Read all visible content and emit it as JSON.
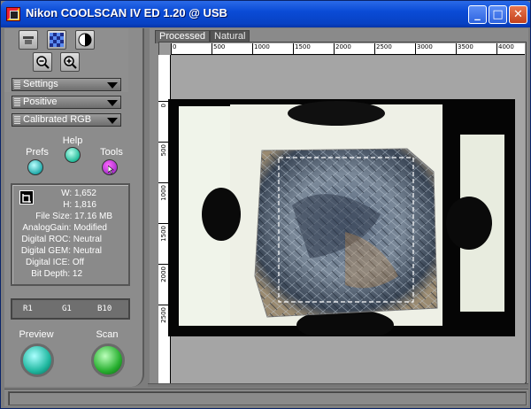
{
  "window": {
    "title": "Nikon COOLSCAN IV ED 1.20 @ USB",
    "minimize_label": "_",
    "maximize_label": "□",
    "close_label": "✕"
  },
  "toolbar": {
    "icons": [
      "scanner-icon",
      "checkerboard-icon",
      "contrast-icon",
      "zoom-out-icon",
      "zoom-in-icon"
    ]
  },
  "dropdowns": {
    "settings": "Settings",
    "film_type": "Positive",
    "color_space": "Calibrated RGB"
  },
  "tools": {
    "prefs": "Prefs",
    "help": "Help",
    "tools": "Tools"
  },
  "info": {
    "width": "W: 1,652",
    "height": "H: 1,816",
    "file_size": "File Size: 17.16 MB",
    "analog_gain": "AnalogGain: Modified",
    "digital_roc": "Digital ROC: Neutral",
    "digital_gem": "Digital GEM: Neutral",
    "digital_ice": "Digital ICE: Off",
    "bit_depth": "Bit Depth: 12"
  },
  "rgb_readout": {
    "r": "R1",
    "g": "G1",
    "b": "B10"
  },
  "actions": {
    "preview": "Preview",
    "scan": "Scan"
  },
  "tabs": [
    {
      "label": "Processed",
      "active": true
    },
    {
      "label": "Natural",
      "active": false
    }
  ],
  "ruler": {
    "top_ticks": [
      "0",
      "500",
      "1000",
      "1500",
      "2000",
      "2500",
      "3000",
      "3500",
      "4000"
    ],
    "left_ticks": [
      "0",
      "500",
      "1000",
      "1500",
      "2000",
      "2500"
    ]
  },
  "colors": {
    "titlebar": "#0a4bd6",
    "panel": "#8c8c8c",
    "preview_button": "#20b8a0",
    "scan_button": "#28b030"
  }
}
